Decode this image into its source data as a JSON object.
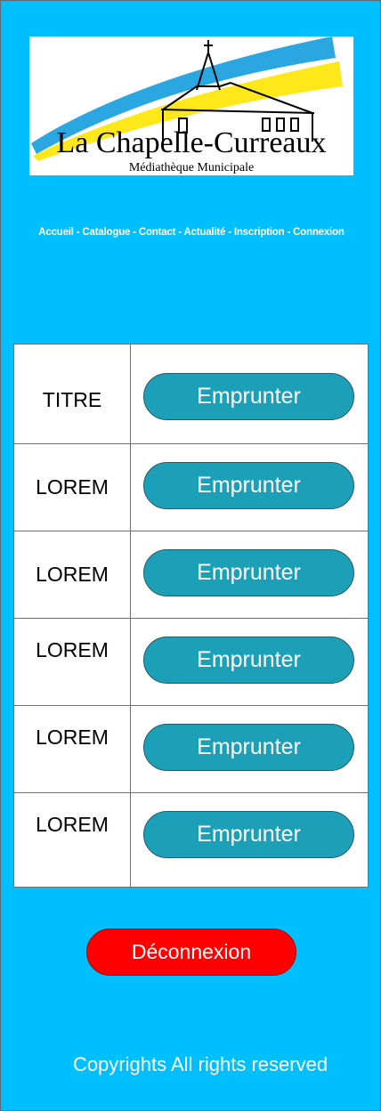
{
  "logo": {
    "title": "La Chapelle-Curreaux",
    "subtitle": "Médiathèque Municipale"
  },
  "nav": {
    "items": [
      "Accueil",
      "Catalogue",
      "Contact",
      "Actualité",
      "Inscription",
      "Connexion"
    ],
    "separator": " - "
  },
  "table": {
    "rows": [
      {
        "title": "TITRE",
        "button": "Emprunter"
      },
      {
        "title": "LOREM",
        "button": "Emprunter"
      },
      {
        "title": "LOREM",
        "button": "Emprunter"
      },
      {
        "title": "LOREM",
        "button": "Emprunter"
      },
      {
        "title": "LOREM",
        "button": "Emprunter"
      },
      {
        "title": "LOREM",
        "button": "Emprunter"
      }
    ]
  },
  "logout_label": "Déconnexion",
  "footer": "Copyrights All rights reserved",
  "colors": {
    "background": "#00bfff",
    "button": "#1ca0b8",
    "logout": "#ff0000"
  }
}
